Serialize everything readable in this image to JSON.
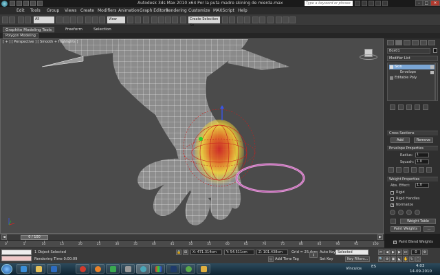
{
  "window": {
    "title": "Autodesk 3ds Max  2010 x64      Por la puta madre skining de mierda.max",
    "search_placeholder": "Type a keyword or phrase",
    "minimize": "–",
    "maximize": "□",
    "close": "✕"
  },
  "menu": [
    "Edit",
    "Tools",
    "Group",
    "Views",
    "Create",
    "Modifiers",
    "Animation",
    "Graph Editors",
    "Rendering",
    "Customize",
    "MAXScript",
    "Help"
  ],
  "toolbar": {
    "selection_filter": "All",
    "reference_coord": "View",
    "named_selection": "Create Selection Se"
  },
  "ribbon": {
    "tabs": [
      "Graphite Modeling Tools",
      "Freeform",
      "Selection"
    ],
    "active_panel": "Polygon Modeling"
  },
  "viewport": {
    "label": "[ + ] [ Perspective ] [ Smooth + Highlights ]"
  },
  "command_panel": {
    "object_name": "Box01",
    "modifier_list": "Modifier List",
    "stack": [
      {
        "label": "Skin",
        "selected": true
      },
      {
        "label": "Envelope",
        "selected": false
      },
      {
        "label": "Editable Poly",
        "selected": false
      }
    ],
    "cross_sections": {
      "title": "Cross Sections",
      "add": "Add",
      "remove": "Remove"
    },
    "envelope_properties": {
      "title": "Envelope Properties",
      "radius_label": "Radius:",
      "radius_value": "1",
      "squash_label": "Squash:",
      "squash_value": "1.0"
    },
    "weight_properties": {
      "title": "Weight Properties",
      "abs_effect_label": "Abs. Effect:",
      "abs_effect_value": "1.0",
      "rigid": "Rigid",
      "rigid_handles": "Rigid Handles",
      "normalize": "Normalize",
      "normalize_checked": true,
      "weight_table": "Weight Table",
      "paint_weights": "Paint Weights",
      "paint_blend": "Paint Blend Weights",
      "paint_blend_checked": true
    }
  },
  "timeline": {
    "slider": "0 / 100",
    "ticks": [
      "0",
      "5",
      "10",
      "15",
      "20",
      "25",
      "30",
      "35",
      "40",
      "45",
      "50",
      "55",
      "60",
      "65",
      "70",
      "75",
      "80",
      "85",
      "90",
      "95",
      "100"
    ]
  },
  "status": {
    "selected": "1 Object Selected",
    "rendering_time": "Rendering Time  0:00:09",
    "x": "X: 471.314cm",
    "y": "Y: 54.511cm",
    "z": "Z: 101.438cm",
    "grid": "Grid = 25.4cm",
    "add_time_tag": "Add Time Tag",
    "auto_key": "Auto Key",
    "auto_key_value": "Selected",
    "set_key": "Set Key",
    "key_filters": "Key Filters..."
  },
  "taskbar": {
    "tray_label": "Vínculos",
    "lang": "ES",
    "time": "4:03",
    "date": "14-09-2010"
  },
  "colors": {
    "viewport_bg": "#4b4b4b",
    "selection_blue": "#7aa6d6",
    "envelope_red": "#c8201e",
    "bone_pink": "#e39ad7",
    "weight_yellow": "#f0d23a"
  }
}
